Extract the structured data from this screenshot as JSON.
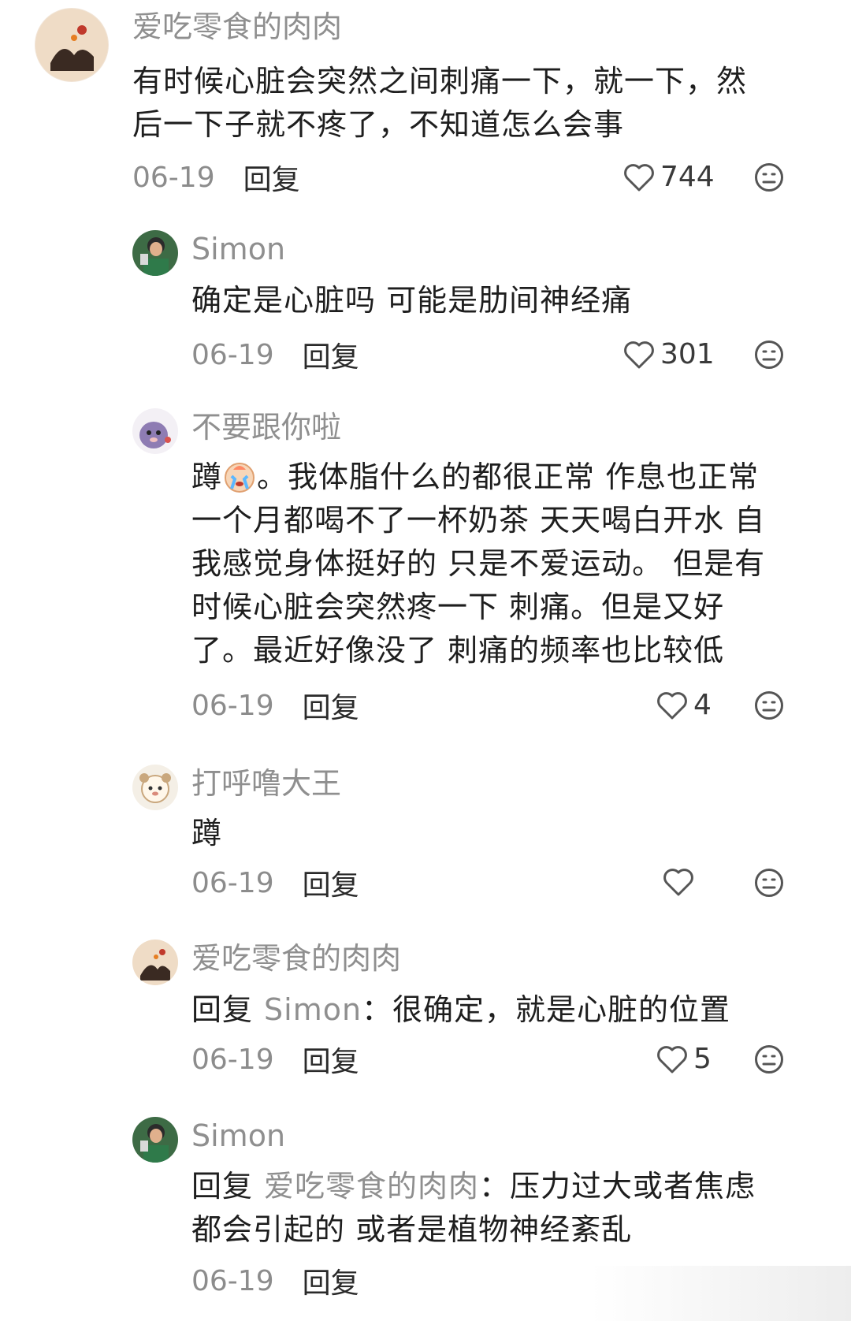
{
  "comments": [
    {
      "username": "爱吃零食的肉肉",
      "text_lines": [
        "有时候心脏会突然之间刺痛一下，就一下，然",
        "后一下子就不疼了，不知道怎么会事"
      ],
      "date": "06-19",
      "reply_label": "回复",
      "likes": "744"
    },
    {
      "username": "Simon",
      "text_lines": [
        "确定是心脏吗 可能是肋间神经痛"
      ],
      "date": "06-19",
      "reply_label": "回复",
      "likes": "301"
    },
    {
      "username": "不要跟你啦",
      "text_first_prefix": "蹲",
      "text_first_suffix": "。我体脂什么的都很正常 作息也正常",
      "text_lines": [
        "一个月都喝不了一杯奶茶 天天喝白开水 自",
        "我感觉身体挺好的 只是不爱运动。 但是有",
        "时候心脏会突然疼一下 刺痛。但是又好",
        "了。最近好像没了 刺痛的频率也比较低"
      ],
      "date": "06-19",
      "reply_label": "回复",
      "likes": "4",
      "emoji": "crying-face-emoji"
    },
    {
      "username": "打呼噜大王",
      "text_lines": [
        "蹲"
      ],
      "date": "06-19",
      "reply_label": "回复",
      "likes": ""
    },
    {
      "username": "爱吃零食的肉肉",
      "reply_prefix": "回复",
      "mention": "Simon",
      "text_lines": [
        "：很确定，就是心脏的位置"
      ],
      "date": "06-19",
      "reply_label": "回复",
      "likes": "5"
    },
    {
      "username": "Simon",
      "reply_prefix": "回复",
      "mention": "爱吃零食的肉肉",
      "text_lines": [
        "：压力过大或者焦虑",
        "都会引起的 或者是植物神经紊乱"
      ],
      "date": "06-19",
      "reply_label": "回复",
      "likes": ""
    }
  ],
  "colors": {
    "username": "#8f8f8f",
    "text": "#1e1e1e",
    "date": "#8c8c8c"
  },
  "icons": [
    "heart-outline-icon",
    "dislike-face-icon"
  ]
}
